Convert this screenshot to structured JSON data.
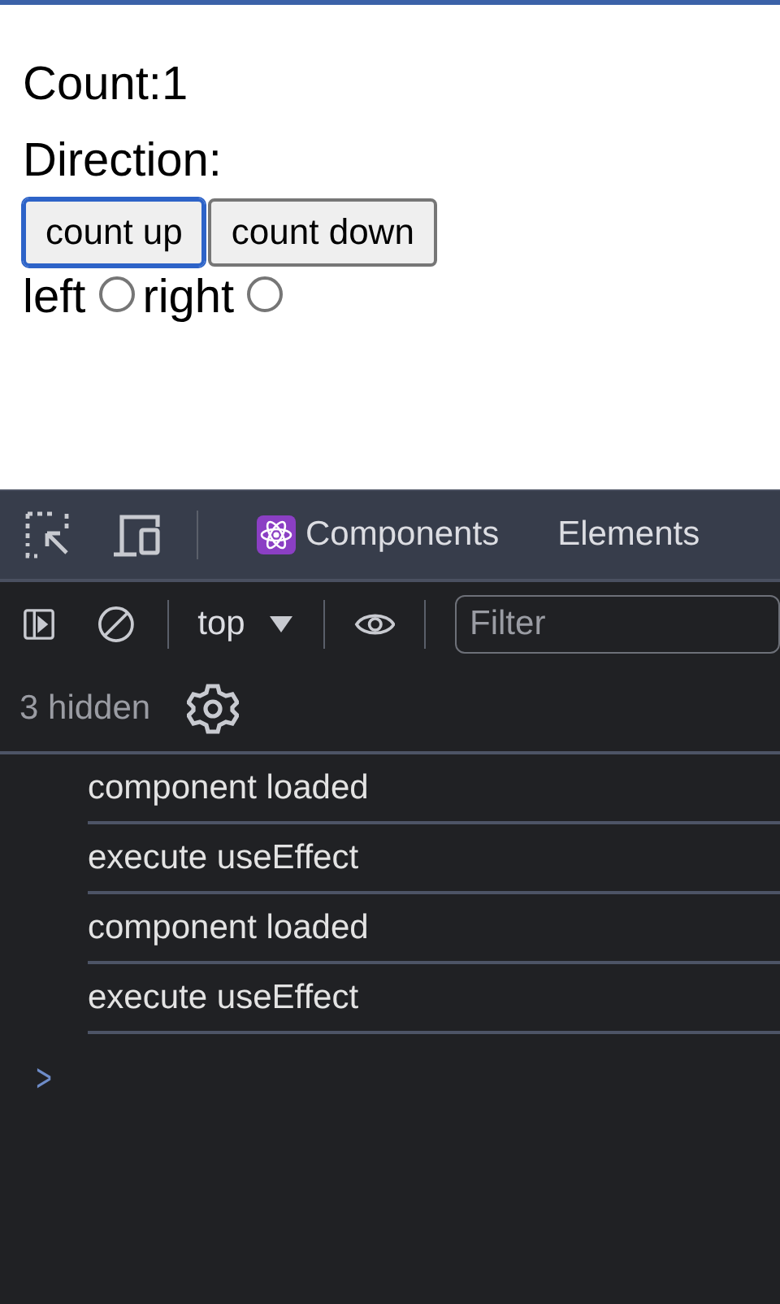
{
  "page": {
    "count_label": "Count:1",
    "direction_label": "Direction:",
    "buttons": [
      {
        "label": "count up",
        "focused": true
      },
      {
        "label": "count down",
        "focused": false
      }
    ],
    "radios": [
      {
        "label": "left",
        "selected": false
      },
      {
        "label": "right",
        "selected": false
      }
    ]
  },
  "devtools": {
    "tabs": [
      {
        "label": "Components",
        "kind": "react",
        "selected": false
      },
      {
        "label": "Elements",
        "kind": "plain",
        "selected": false
      }
    ],
    "context": "top",
    "filter": {
      "placeholder": "Filter"
    },
    "hidden_count": "3 hidden",
    "messages": [
      "component loaded",
      "execute useEffect",
      "component loaded",
      "execute useEffect"
    ],
    "prompt": ">"
  }
}
